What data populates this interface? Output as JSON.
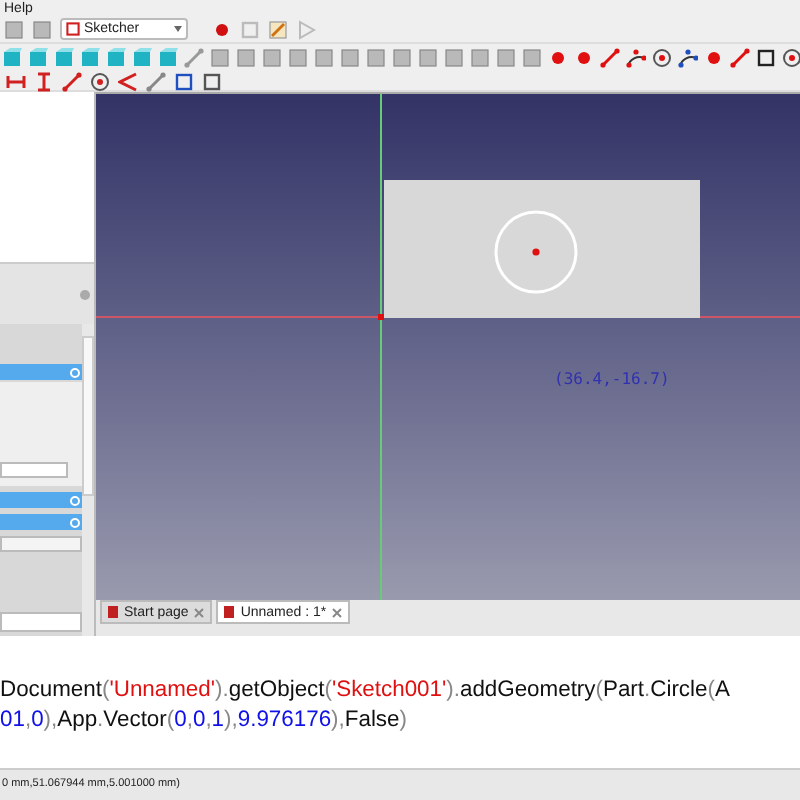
{
  "menu_bar": {
    "items": [
      "Help"
    ]
  },
  "toolbar": {
    "workbench": "Sketcher"
  },
  "viewport": {
    "cursor_coordinates": "(36.4,-16.7)"
  },
  "tabs": [
    {
      "label": "Start page",
      "selected": false
    },
    {
      "label": "Unnamed : 1*",
      "selected": true
    }
  ],
  "python_console": {
    "lines": [
      [
        {
          "kind": "plain",
          "text": "Document"
        },
        {
          "kind": "punct",
          "text": "("
        },
        {
          "kind": "string",
          "text": "'Unnamed'"
        },
        {
          "kind": "punct",
          "text": ")."
        },
        {
          "kind": "plain",
          "text": "getObject"
        },
        {
          "kind": "punct",
          "text": "("
        },
        {
          "kind": "string",
          "text": "'Sketch001'"
        },
        {
          "kind": "punct",
          "text": ")."
        },
        {
          "kind": "plain",
          "text": "addGeometry"
        },
        {
          "kind": "punct",
          "text": "("
        },
        {
          "kind": "plain",
          "text": "Part"
        },
        {
          "kind": "punct",
          "text": "."
        },
        {
          "kind": "plain",
          "text": "Circle"
        },
        {
          "kind": "punct",
          "text": "("
        },
        {
          "kind": "plain",
          "text": "A"
        }
      ],
      [
        {
          "kind": "number",
          "text": "01"
        },
        {
          "kind": "punct",
          "text": ","
        },
        {
          "kind": "number",
          "text": "0"
        },
        {
          "kind": "punct",
          "text": "),"
        },
        {
          "kind": "plain",
          "text": "App"
        },
        {
          "kind": "punct",
          "text": "."
        },
        {
          "kind": "plain",
          "text": "Vector"
        },
        {
          "kind": "punct",
          "text": "("
        },
        {
          "kind": "number",
          "text": "0"
        },
        {
          "kind": "punct",
          "text": ","
        },
        {
          "kind": "number",
          "text": "0"
        },
        {
          "kind": "punct",
          "text": ","
        },
        {
          "kind": "number",
          "text": "1"
        },
        {
          "kind": "punct",
          "text": "),"
        },
        {
          "kind": "number",
          "text": "9.976176"
        },
        {
          "kind": "punct",
          "text": "),"
        },
        {
          "kind": "plain",
          "text": "False"
        },
        {
          "kind": "punct",
          "text": ")"
        }
      ]
    ]
  },
  "status_bar": {
    "text": "0 mm,51.067944 mm,5.001000 mm)"
  }
}
